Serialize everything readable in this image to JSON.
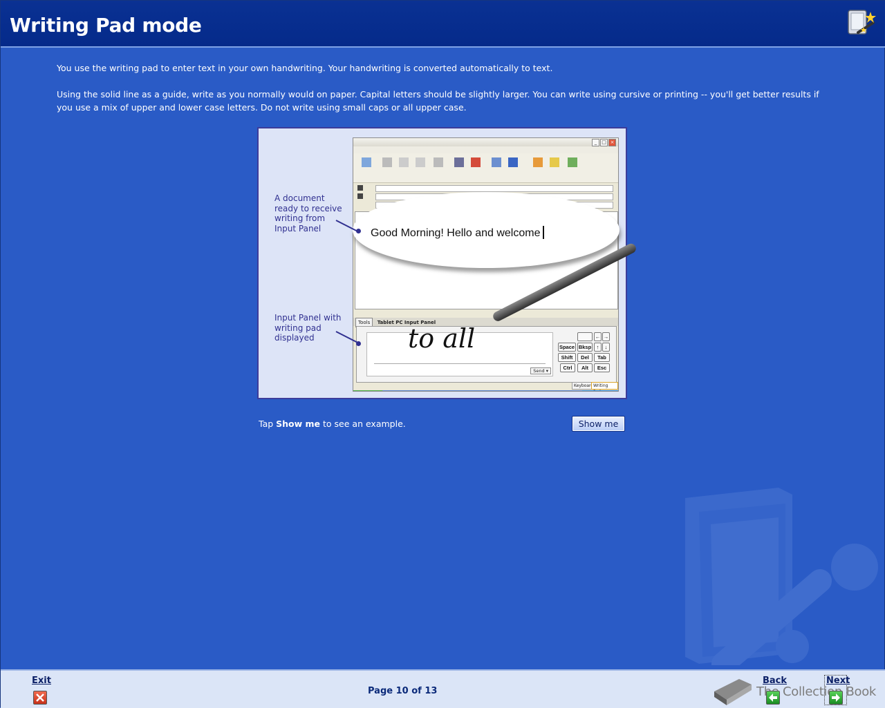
{
  "header": {
    "title": "Writing Pad mode",
    "icon": "tablet-pc-icon"
  },
  "content": {
    "paragraph1": "You use the writing pad to enter text in your own handwriting. Your handwriting is converted automatically to text.",
    "paragraph2": "Using the solid line as a guide, write as you normally would on paper. Capital letters should be slightly larger. You can write using cursive or printing -- you'll get better results if you use a mix of upper and lower case letters. Do not write using small caps or all upper case."
  },
  "figure": {
    "callout_document": "A document ready to receive writing from Input Panel",
    "callout_input_panel": "Input Panel with writing pad displayed",
    "bubble_text": "Good Morning! Hello and welcome",
    "handwriting": "to all",
    "panel_title": "Tablet PC Input Panel",
    "tools_label": "Tools",
    "send_label": "Send",
    "keys": [
      "Space",
      "Bksp",
      "Shift",
      "Del",
      "Tab",
      "Ctrl",
      "Alt",
      "Esc"
    ],
    "tabs": [
      "Keyboard",
      "Writing Pad"
    ]
  },
  "tap": {
    "prefix": "Tap ",
    "bold": "Show me",
    "suffix": " to see an example.",
    "button_label": "Show me"
  },
  "footer": {
    "exit_label": "Exit",
    "page_indicator": "Page 10 of 13",
    "back_label": "Back",
    "next_label": "Next",
    "brand": "The Collection Book"
  },
  "colors": {
    "background": "#2a5bc6",
    "header": "#0a3193",
    "footer": "#dbe5f7",
    "callout_text": "#303090"
  }
}
